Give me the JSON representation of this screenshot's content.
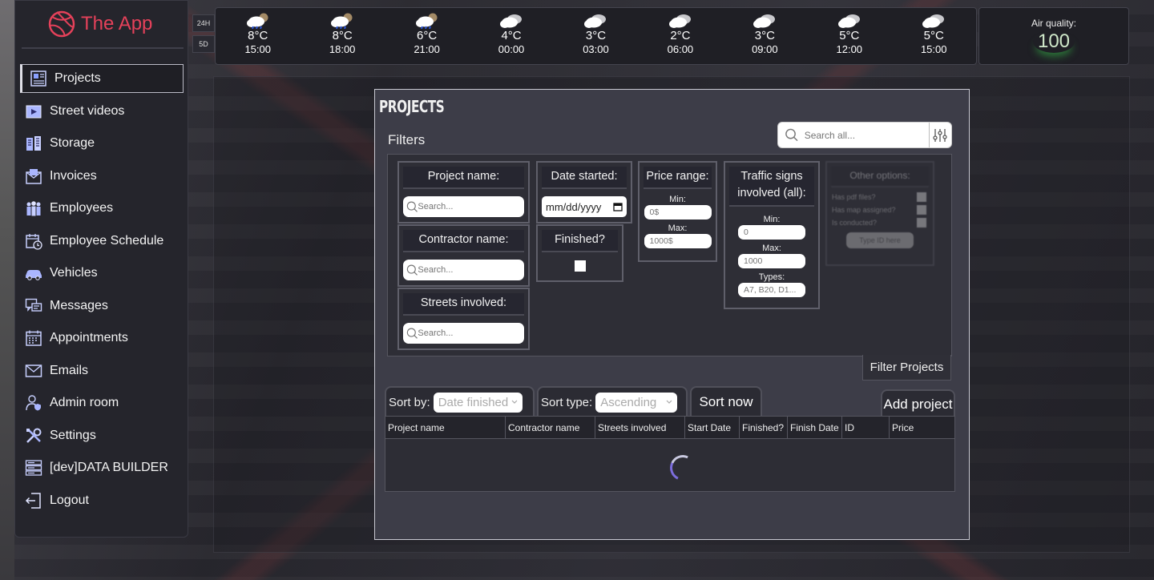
{
  "app": {
    "name": "The App",
    "accent": "#e5415a"
  },
  "sidebar": {
    "items": [
      {
        "label": "Projects",
        "icon": "projects-icon",
        "active": true
      },
      {
        "label": "Street videos",
        "icon": "video-icon"
      },
      {
        "label": "Storage",
        "icon": "storage-icon"
      },
      {
        "label": "Invoices",
        "icon": "invoice-icon"
      },
      {
        "label": "Employees",
        "icon": "employees-icon"
      },
      {
        "label": "Employee Schedule",
        "icon": "calendar-clock-icon"
      },
      {
        "label": "Vehicles",
        "icon": "car-icon"
      },
      {
        "label": "Messages",
        "icon": "messages-icon"
      },
      {
        "label": "Appointments",
        "icon": "calendar-icon"
      },
      {
        "label": "Emails",
        "icon": "mail-icon"
      },
      {
        "label": "Admin room",
        "icon": "admin-user-icon"
      },
      {
        "label": "Settings",
        "icon": "tools-icon"
      },
      {
        "label": "[dev]DATA BUILDER",
        "icon": "server-icon"
      },
      {
        "label": "Logout",
        "icon": "logout-icon"
      }
    ]
  },
  "weather": {
    "ranges": [
      "24H",
      "5D"
    ],
    "hours": [
      {
        "temp": "8°C",
        "time": "15:00",
        "icon": "rain-night-icon"
      },
      {
        "temp": "8°C",
        "time": "18:00",
        "icon": "rain-night-icon"
      },
      {
        "temp": "6°C",
        "time": "21:00",
        "icon": "rain-night-icon"
      },
      {
        "temp": "4°C",
        "time": "00:00",
        "icon": "cloud-icon"
      },
      {
        "temp": "3°C",
        "time": "03:00",
        "icon": "cloud-icon"
      },
      {
        "temp": "2°C",
        "time": "06:00",
        "icon": "cloud-icon"
      },
      {
        "temp": "3°C",
        "time": "09:00",
        "icon": "cloud-icon"
      },
      {
        "temp": "5°C",
        "time": "12:00",
        "icon": "cloud-icon"
      },
      {
        "temp": "5°C",
        "time": "15:00",
        "icon": "cloud-icon"
      }
    ],
    "air_quality_label": "Air quality:",
    "air_quality_value": "100"
  },
  "projects": {
    "title": "PROJECTS",
    "filters_label": "Filters",
    "search_placeholder": "Search all...",
    "filters": {
      "project_name": {
        "label": "Project name:",
        "placeholder": "Search..."
      },
      "contractor_name": {
        "label": "Contractor name:",
        "placeholder": "Search..."
      },
      "streets_involved": {
        "label": "Streets involved:",
        "placeholder": "Search..."
      },
      "date_started": {
        "label": "Date started:",
        "value": "mm/dd/yyyy"
      },
      "finished": {
        "label": "Finished?"
      },
      "price_range": {
        "label": "Price range:",
        "min_label": "Min:",
        "min_placeholder": "0$",
        "max_label": "Max:",
        "max_placeholder": "1000$"
      },
      "traffic_signs": {
        "label": "Traffic signs involved (all):",
        "min_label": "Min:",
        "min_placeholder": "0",
        "max_label": "Max:",
        "max_placeholder": "1000",
        "types_label": "Types:",
        "types_placeholder": "A7, B20, D1..."
      },
      "other_options": {
        "label": "Other options:",
        "opt1": "Has pdf files?",
        "opt2": "Has map assigned?",
        "opt3": "Is conducted?",
        "button": "Type ID here"
      }
    },
    "filter_button": "Filter Projects",
    "sort_by_label": "Sort by:",
    "sort_by_value": "Date finished",
    "sort_type_label": "Sort type:",
    "sort_type_value": "Ascending",
    "sort_now": "Sort now",
    "add_project": "Add project",
    "columns": [
      "Project name",
      "Contractor name",
      "Streets involved",
      "Start Date",
      "Finished?",
      "Finish Date",
      "ID",
      "Price"
    ]
  }
}
